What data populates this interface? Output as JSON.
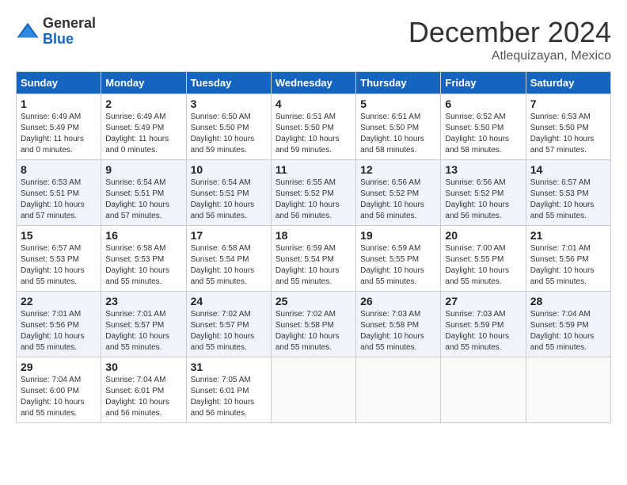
{
  "logo": {
    "general": "General",
    "blue": "Blue"
  },
  "title": "December 2024",
  "location": "Atlequizayan, Mexico",
  "weekdays": [
    "Sunday",
    "Monday",
    "Tuesday",
    "Wednesday",
    "Thursday",
    "Friday",
    "Saturday"
  ],
  "weeks": [
    [
      {
        "day": "1",
        "sunrise": "6:49 AM",
        "sunset": "5:49 PM",
        "daylight": "11 hours and 0 minutes."
      },
      {
        "day": "2",
        "sunrise": "6:49 AM",
        "sunset": "5:49 PM",
        "daylight": "11 hours and 0 minutes."
      },
      {
        "day": "3",
        "sunrise": "6:50 AM",
        "sunset": "5:50 PM",
        "daylight": "10 hours and 59 minutes."
      },
      {
        "day": "4",
        "sunrise": "6:51 AM",
        "sunset": "5:50 PM",
        "daylight": "10 hours and 59 minutes."
      },
      {
        "day": "5",
        "sunrise": "6:51 AM",
        "sunset": "5:50 PM",
        "daylight": "10 hours and 58 minutes."
      },
      {
        "day": "6",
        "sunrise": "6:52 AM",
        "sunset": "5:50 PM",
        "daylight": "10 hours and 58 minutes."
      },
      {
        "day": "7",
        "sunrise": "6:53 AM",
        "sunset": "5:50 PM",
        "daylight": "10 hours and 57 minutes."
      }
    ],
    [
      {
        "day": "8",
        "sunrise": "6:53 AM",
        "sunset": "5:51 PM",
        "daylight": "10 hours and 57 minutes."
      },
      {
        "day": "9",
        "sunrise": "6:54 AM",
        "sunset": "5:51 PM",
        "daylight": "10 hours and 57 minutes."
      },
      {
        "day": "10",
        "sunrise": "6:54 AM",
        "sunset": "5:51 PM",
        "daylight": "10 hours and 56 minutes."
      },
      {
        "day": "11",
        "sunrise": "6:55 AM",
        "sunset": "5:52 PM",
        "daylight": "10 hours and 56 minutes."
      },
      {
        "day": "12",
        "sunrise": "6:56 AM",
        "sunset": "5:52 PM",
        "daylight": "10 hours and 56 minutes."
      },
      {
        "day": "13",
        "sunrise": "6:56 AM",
        "sunset": "5:52 PM",
        "daylight": "10 hours and 56 minutes."
      },
      {
        "day": "14",
        "sunrise": "6:57 AM",
        "sunset": "5:53 PM",
        "daylight": "10 hours and 55 minutes."
      }
    ],
    [
      {
        "day": "15",
        "sunrise": "6:57 AM",
        "sunset": "5:53 PM",
        "daylight": "10 hours and 55 minutes."
      },
      {
        "day": "16",
        "sunrise": "6:58 AM",
        "sunset": "5:53 PM",
        "daylight": "10 hours and 55 minutes."
      },
      {
        "day": "17",
        "sunrise": "6:58 AM",
        "sunset": "5:54 PM",
        "daylight": "10 hours and 55 minutes."
      },
      {
        "day": "18",
        "sunrise": "6:59 AM",
        "sunset": "5:54 PM",
        "daylight": "10 hours and 55 minutes."
      },
      {
        "day": "19",
        "sunrise": "6:59 AM",
        "sunset": "5:55 PM",
        "daylight": "10 hours and 55 minutes."
      },
      {
        "day": "20",
        "sunrise": "7:00 AM",
        "sunset": "5:55 PM",
        "daylight": "10 hours and 55 minutes."
      },
      {
        "day": "21",
        "sunrise": "7:01 AM",
        "sunset": "5:56 PM",
        "daylight": "10 hours and 55 minutes."
      }
    ],
    [
      {
        "day": "22",
        "sunrise": "7:01 AM",
        "sunset": "5:56 PM",
        "daylight": "10 hours and 55 minutes."
      },
      {
        "day": "23",
        "sunrise": "7:01 AM",
        "sunset": "5:57 PM",
        "daylight": "10 hours and 55 minutes."
      },
      {
        "day": "24",
        "sunrise": "7:02 AM",
        "sunset": "5:57 PM",
        "daylight": "10 hours and 55 minutes."
      },
      {
        "day": "25",
        "sunrise": "7:02 AM",
        "sunset": "5:58 PM",
        "daylight": "10 hours and 55 minutes."
      },
      {
        "day": "26",
        "sunrise": "7:03 AM",
        "sunset": "5:58 PM",
        "daylight": "10 hours and 55 minutes."
      },
      {
        "day": "27",
        "sunrise": "7:03 AM",
        "sunset": "5:59 PM",
        "daylight": "10 hours and 55 minutes."
      },
      {
        "day": "28",
        "sunrise": "7:04 AM",
        "sunset": "5:59 PM",
        "daylight": "10 hours and 55 minutes."
      }
    ],
    [
      {
        "day": "29",
        "sunrise": "7:04 AM",
        "sunset": "6:00 PM",
        "daylight": "10 hours and 55 minutes."
      },
      {
        "day": "30",
        "sunrise": "7:04 AM",
        "sunset": "6:01 PM",
        "daylight": "10 hours and 56 minutes."
      },
      {
        "day": "31",
        "sunrise": "7:05 AM",
        "sunset": "6:01 PM",
        "daylight": "10 hours and 56 minutes."
      },
      null,
      null,
      null,
      null
    ]
  ],
  "labels": {
    "sunrise": "Sunrise:",
    "sunset": "Sunset:",
    "daylight": "Daylight:"
  }
}
